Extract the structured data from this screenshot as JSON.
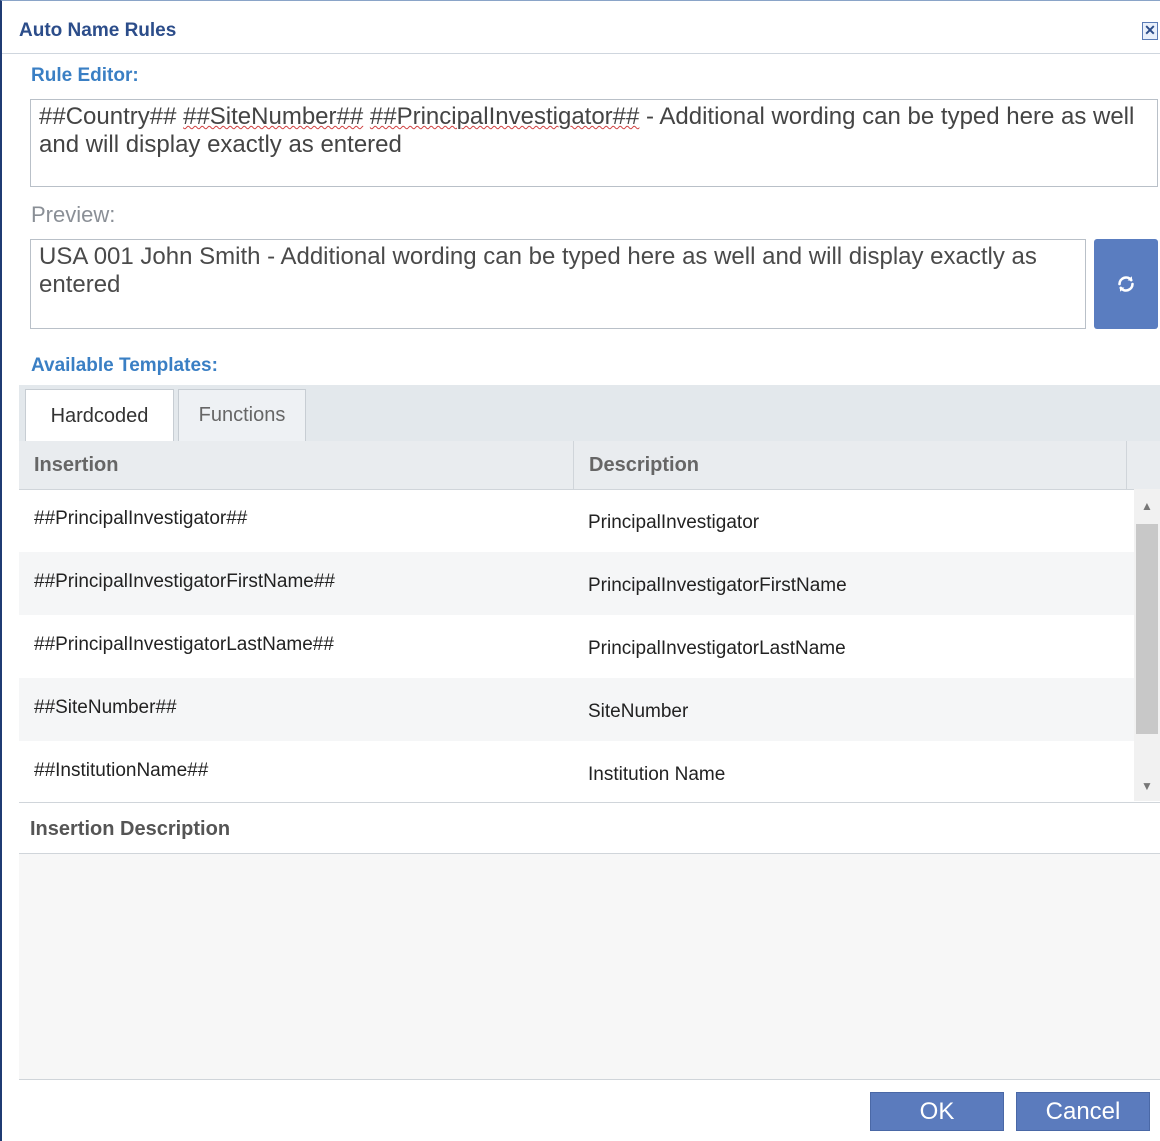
{
  "dialog": {
    "title": "Auto Name Rules",
    "close_icon": "close-icon"
  },
  "rule_editor": {
    "label": "Rule Editor:",
    "text_parts": [
      "##Country## ",
      "##SiteNumber##",
      " ",
      "##PrincipalInvestigator##",
      " - Additional wording can be typed here as well and will display exactly as entered"
    ]
  },
  "preview": {
    "label": "Preview:",
    "text": "USA 001 John Smith - Additional wording can be typed here as well and will display exactly as entered",
    "refresh_icon": "refresh-icon"
  },
  "templates": {
    "label": "Available Templates:",
    "tabs": [
      {
        "label": "Hardcoded",
        "active": true
      },
      {
        "label": "Functions",
        "active": false
      }
    ],
    "columns": [
      "Insertion",
      "Description"
    ],
    "rows": [
      {
        "insertion": "##PrincipalInvestigator##",
        "description": "PrincipalInvestigator"
      },
      {
        "insertion": "##PrincipalInvestigatorFirstName##",
        "description": "PrincipalInvestigatorFirstName"
      },
      {
        "insertion": "##PrincipalInvestigatorLastName##",
        "description": "PrincipalInvestigatorLastName"
      },
      {
        "insertion": "##SiteNumber##",
        "description": "SiteNumber"
      },
      {
        "insertion": "##InstitutionName##",
        "description": "Institution Name"
      }
    ]
  },
  "insertion_description": {
    "label": "Insertion Description"
  },
  "buttons": {
    "ok": "OK",
    "cancel": "Cancel"
  },
  "colors": {
    "accent": "#5b7bbd",
    "title": "#2c4d8a",
    "section_label": "#3a7fc4"
  }
}
